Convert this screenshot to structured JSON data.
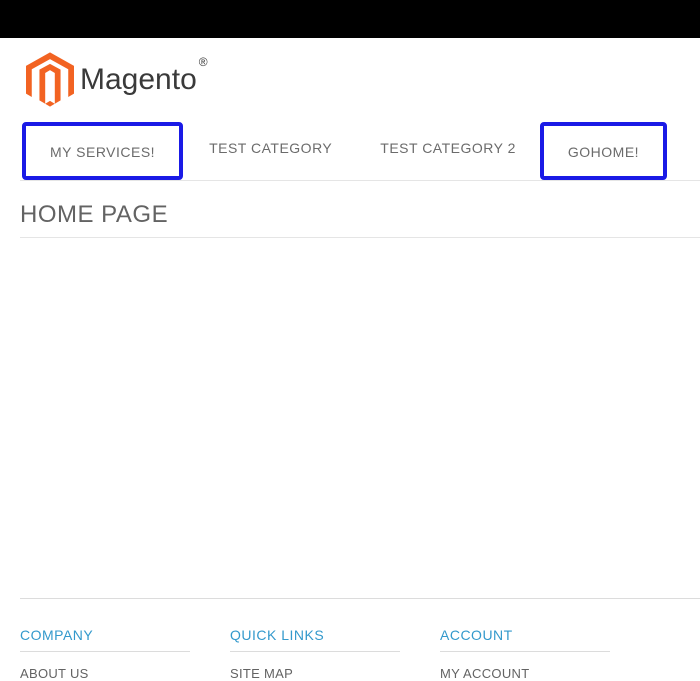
{
  "brand": {
    "name": "Magento",
    "trademark": "®"
  },
  "nav": {
    "items": [
      {
        "label": "MY SERVICES!",
        "highlighted": true
      },
      {
        "label": "TEST CATEGORY",
        "highlighted": false
      },
      {
        "label": "TEST CATEGORY 2",
        "highlighted": false
      },
      {
        "label": "GOHOME!",
        "highlighted": true
      }
    ]
  },
  "page": {
    "title": "HOME PAGE"
  },
  "footer": {
    "columns": [
      {
        "heading": "COMPANY",
        "links": [
          "ABOUT US"
        ]
      },
      {
        "heading": "QUICK LINKS",
        "links": [
          "SITE MAP"
        ]
      },
      {
        "heading": "ACCOUNT",
        "links": [
          "MY ACCOUNT"
        ]
      }
    ]
  },
  "colors": {
    "accent": "#f26322",
    "link": "#3399cc",
    "highlight_border": "#1a1ae6"
  }
}
